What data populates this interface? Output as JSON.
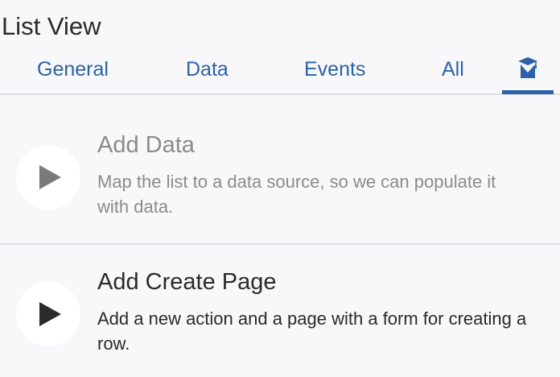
{
  "panel": {
    "title": "List View"
  },
  "tabs": [
    {
      "label": "General"
    },
    {
      "label": "Data"
    },
    {
      "label": "Events"
    },
    {
      "label": "All"
    },
    {
      "icon": "graduation-cap-icon",
      "active": true
    }
  ],
  "items": [
    {
      "heading": "Add Data",
      "description": "Map the list to a data source, so we can populate it with data.",
      "state": "completed",
      "icon": "play-icon"
    },
    {
      "heading": "Add Create Page",
      "description": "Add a new action and a page with a form for creating a row.",
      "state": "pending",
      "icon": "play-icon"
    }
  ],
  "colors": {
    "accent": "#2a62a8",
    "background": "#f8f8fa",
    "divider": "#dcdde2",
    "muted_text": "#8b8b8b",
    "text": "#2a2a2a",
    "muted_icon": "#7a7a7a",
    "active_icon": "#2a2a2a"
  }
}
